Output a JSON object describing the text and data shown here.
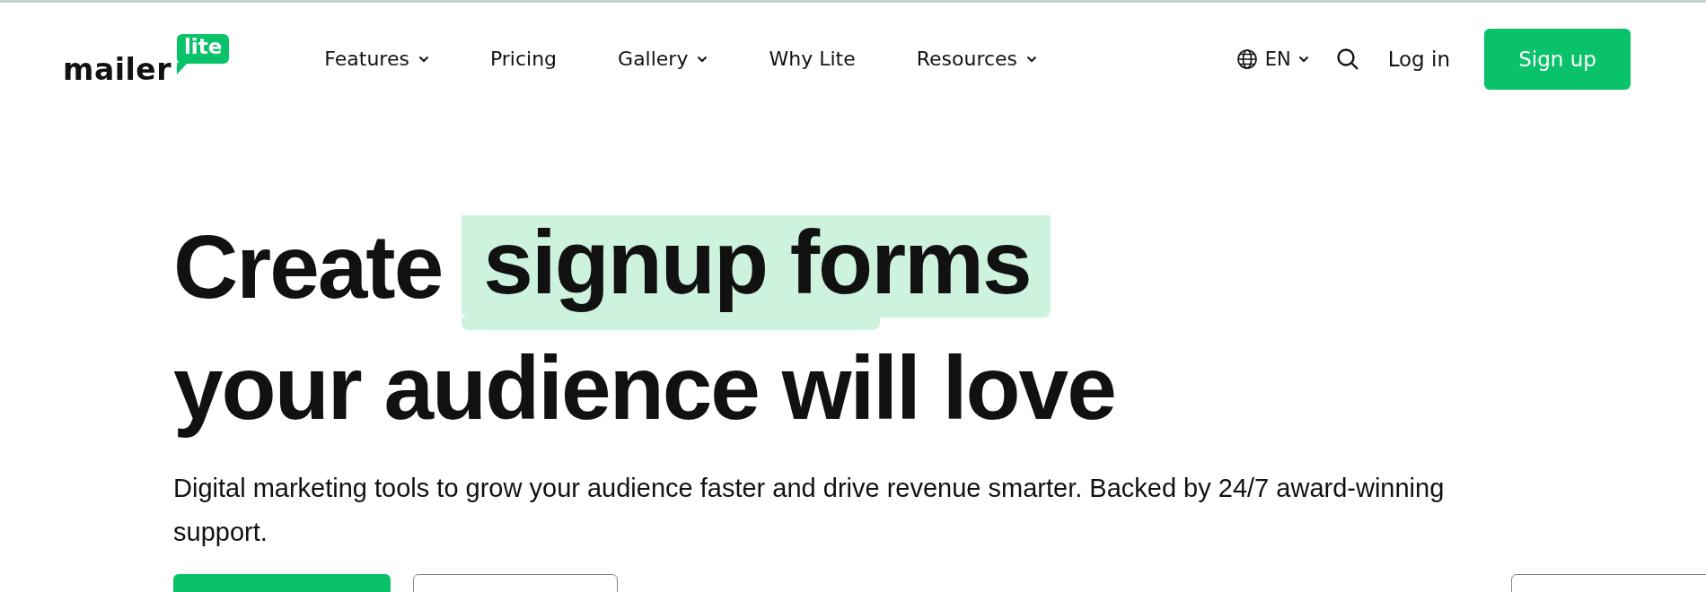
{
  "logo": {
    "word": "mailer",
    "badge": "lite"
  },
  "nav": [
    {
      "label": "Features",
      "dropdown": true
    },
    {
      "label": "Pricing",
      "dropdown": false
    },
    {
      "label": "Gallery",
      "dropdown": true
    },
    {
      "label": "Why Lite",
      "dropdown": false
    },
    {
      "label": "Resources",
      "dropdown": true
    }
  ],
  "language": {
    "label": "EN",
    "dropdown": true
  },
  "login": "Log in",
  "signup": "Sign up",
  "hero": {
    "headline_start": "Create",
    "headline_highlight": "signup forms",
    "headline_end": "your audience will love",
    "description": "Digital marketing tools to grow your audience faster and drive revenue smarter. Backed by 24/7 award-winning support.",
    "cut_buttons": [
      {
        "kind": "filled"
      },
      {
        "kind": "outlined"
      },
      {
        "kind": "outlined"
      }
    ]
  }
}
